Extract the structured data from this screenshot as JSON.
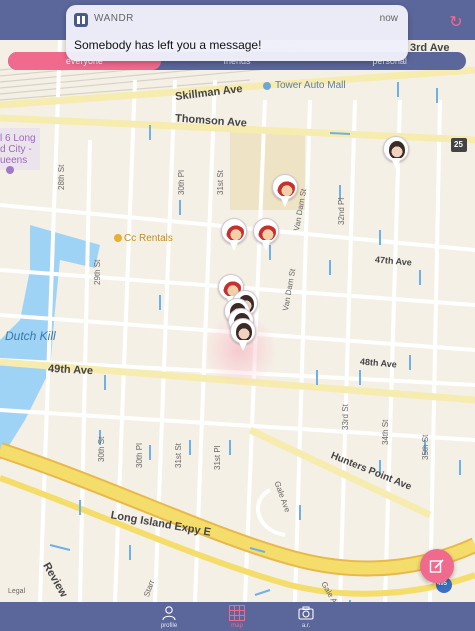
{
  "notification": {
    "app_name": "WANDR",
    "time": "now",
    "message": "Somebody has left you a message!"
  },
  "filter_tabs": [
    {
      "label": "everyone",
      "active": true
    },
    {
      "label": "friends",
      "active": false
    },
    {
      "label": "personal",
      "active": false
    }
  ],
  "map": {
    "avenues": {
      "thomson": "Thomson Ave",
      "skillman": "Skillman Ave",
      "third": "3rd Ave",
      "forty_seventh": "47th Ave",
      "forty_eighth": "48th Ave",
      "forty_ninth": "49th Ave",
      "hunters_point": "Hunters Point Ave",
      "lie": "Long Island Expy E",
      "review": "Review"
    },
    "streets": {
      "s28": "28th St",
      "s29": "29th St",
      "p30": "30th Pl",
      "s31": "31st St",
      "s30": "30th St",
      "p30b": "30th Pl",
      "s31b": "31st St",
      "p31": "31st Pl",
      "van_dam_1": "Van Dam St",
      "van_dam_2": "Van Dam St",
      "s32": "32nd Pl",
      "s33": "33rd St",
      "s34": "34th St",
      "s35": "35th St",
      "gale_1": "Gale Ave",
      "gale_2": "Gale Ave",
      "starr": "Starr"
    },
    "water": "Dutch Kill",
    "poi_tower": "Tower Auto Mall",
    "poi_cc": "Cc Rentals",
    "area": [
      "l 6 Long",
      "d City -",
      "ueens"
    ],
    "route_25": "25",
    "route_495": "495",
    "legal": "Legal"
  },
  "tabbar": [
    {
      "label": "profile",
      "icon": "person-icon"
    },
    {
      "label": "map",
      "icon": "map-grid-icon"
    },
    {
      "label": "a.r.",
      "icon": "camera-icon"
    }
  ],
  "colors": {
    "accent": "#f06a8e",
    "bar": "#5b669b",
    "road_major": "#f4dd6a",
    "water": "#9fd3f5",
    "land": "#f5f0e6"
  }
}
